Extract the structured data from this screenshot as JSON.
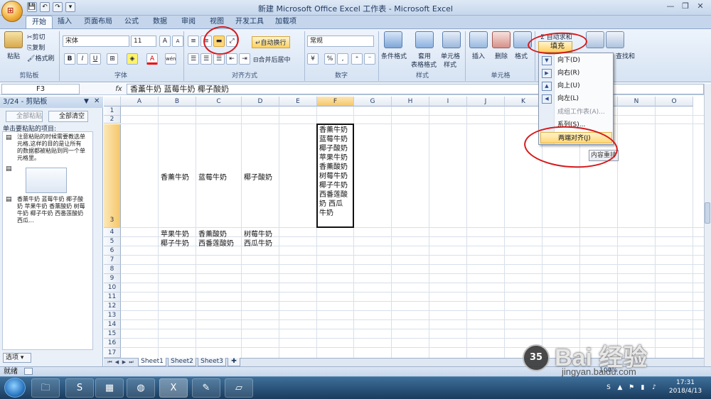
{
  "window": {
    "title": "新建 Microsoft Office Excel 工作表 - Microsoft Excel",
    "office_btn": "⊞",
    "quick_access": [
      "💾",
      "↶",
      "↷",
      "▾"
    ],
    "controls": [
      "—",
      "❐",
      "✕"
    ]
  },
  "tabs": [
    "开始",
    "插入",
    "页面布局",
    "公式",
    "数据",
    "审阅",
    "视图",
    "开发工具",
    "加载项"
  ],
  "ribbon": {
    "clipboard": {
      "paste": "粘贴",
      "cut": "剪切",
      "copy": "复制",
      "painter": "格式刷",
      "label": "剪贴板"
    },
    "font": {
      "name": "宋体",
      "size": "11",
      "grow": "A",
      "shrink": "A",
      "bold": "B",
      "italic": "I",
      "underline": "U",
      "fontcolor": "A",
      "wen": "wén",
      "label": "字体"
    },
    "align": {
      "wrap": "自动换行",
      "merge": "合并后居中",
      "label": "对齐方式"
    },
    "number": {
      "format": "常规",
      "currency": "¥",
      "percent": "%",
      "comma": ",",
      "label": "数字"
    },
    "styles": {
      "cond": "条件格式",
      "table": "套用",
      "table2": "表格格式",
      "cellstyle": "单元格",
      "cellstyle2": "样式",
      "label": "样式"
    },
    "cells": {
      "insert": "插入",
      "delete": "删除",
      "format": "格式",
      "label": "单元格"
    },
    "editing": {
      "autosum": "自动求和",
      "fill": "填充",
      "sort": "排序和",
      "find": "查找和",
      "label": "编辑"
    }
  },
  "formula_bar": {
    "cell_ref": "F3",
    "fx": "fx",
    "value": "香薰牛奶 蓝莓牛奶 椰子酸奶"
  },
  "clipboard_pane": {
    "title": "3/24 - 剪贴板",
    "paste_all": "全部粘贴",
    "clear_all": "全部清空",
    "hint": "单击要粘贴的项目:",
    "items": [
      "注意粘贴的时候需要教选单元格,这样的目的是让所有的数据都被粘贴到同一个单元格里。",
      "",
      "香薰牛奶 蓝莓牛奶 椰子酸奶 苹果牛奶 香薰酸奶 树莓牛奶 椰子牛奶 西番莲酸奶 西瓜..."
    ],
    "options": "选项 ▾"
  },
  "grid": {
    "columns": [
      "A",
      "B",
      "C",
      "D",
      "E",
      "F",
      "G",
      "H",
      "I",
      "J",
      "K",
      "L",
      "M",
      "N",
      "O"
    ],
    "rows": [
      "1",
      "2",
      "3",
      "4",
      "5",
      "6",
      "7",
      "8",
      "9",
      "10",
      "11",
      "12",
      "13",
      "14",
      "15",
      "16",
      "17"
    ],
    "cells": {
      "B3": "香薰牛奶",
      "C3": "蓝莓牛奶",
      "D3": "椰子酸奶",
      "B4": "苹果牛奶",
      "C4": "香薰酸奶",
      "D4": "树莓牛奶",
      "B5": "椰子牛奶",
      "C5": "西番莲酸奶",
      "D5": "西瓜牛奶",
      "F3": "香薰牛奶\n蓝莓牛奶\n椰子酸奶\n苹果牛奶\n香薰酸奶\n树莓牛奶\n椰子牛奶\n西番莲酸\n奶 西瓜\n牛奶"
    }
  },
  "sheets": [
    "Sheet1",
    "Sheet2",
    "Sheet3"
  ],
  "status": {
    "text": "就绪",
    "zoom": "100%"
  },
  "fill_menu": {
    "items": [
      "向下(D)",
      "向右(R)",
      "向上(U)",
      "向左(L)",
      "成组工作表(A)...",
      "系列(S)...",
      "两端对齐(J)"
    ],
    "tooltip": "内容重排"
  },
  "taskbar": {
    "time": "17:31",
    "date": "2018/4/13"
  },
  "watermark": {
    "badge": "35",
    "brand": "Bai 经验",
    "url": "jingyan.baidu.com"
  },
  "colors": {
    "accent": "#c5d6ec",
    "annotation_red": "#d6191c",
    "highlight": "#ffd777"
  }
}
